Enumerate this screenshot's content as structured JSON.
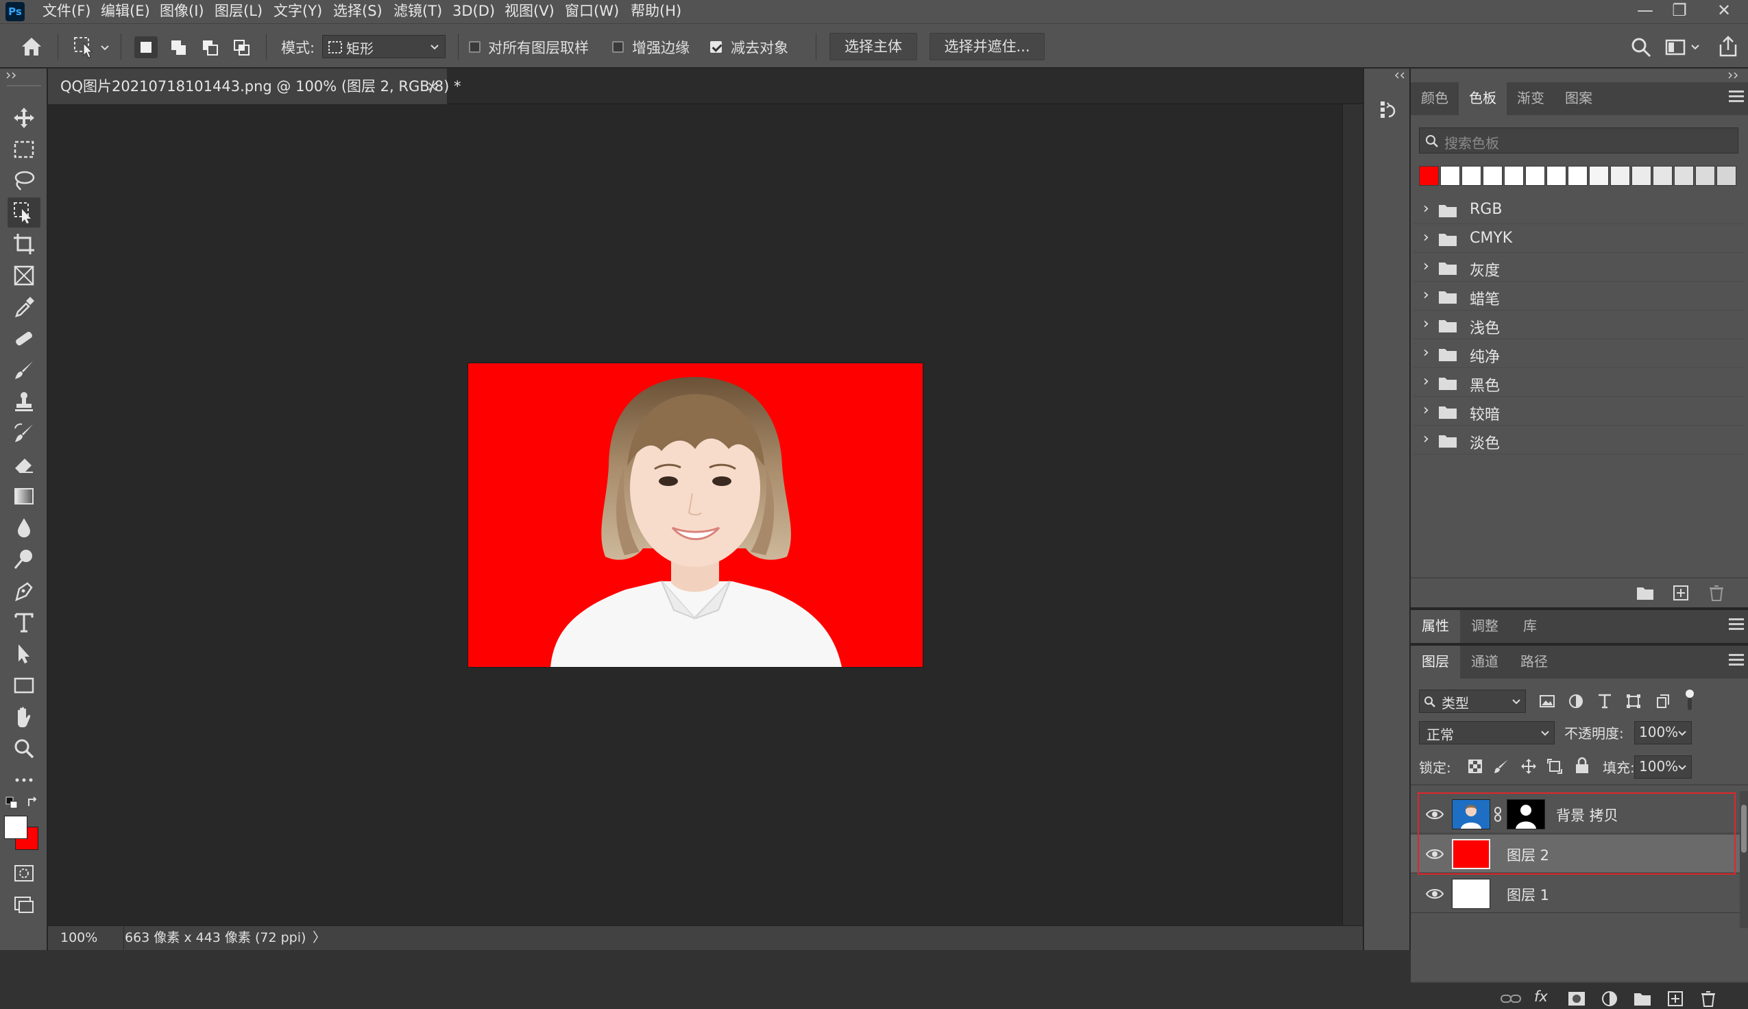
{
  "app": {
    "logo": "Ps"
  },
  "menu": [
    "文件(F)",
    "编辑(E)",
    "图像(I)",
    "图层(L)",
    "文字(Y)",
    "选择(S)",
    "滤镜(T)",
    "3D(D)",
    "视图(V)",
    "窗口(W)",
    "帮助(H)"
  ],
  "window_controls": {
    "minimize": "—",
    "restore": "❐",
    "close": "✕"
  },
  "options": {
    "mode_label": "模式:",
    "mode_value": "矩形",
    "sample_all_layers": {
      "label": "对所有图层取样",
      "checked": false
    },
    "enhance_edge": {
      "label": "增强边缘",
      "checked": false
    },
    "subtract_object": {
      "label": "减去对象",
      "checked": true
    },
    "select_subject_button": "选择主体",
    "select_and_mask_button": "选择并遮住..."
  },
  "document": {
    "tab_title": "QQ图片20210718101443.png @ 100% (图层 2, RGB/8) *",
    "close_glyph": "×",
    "background_color": "#ff0000",
    "zoom": "100%",
    "doc_info": "663 像素 x 443 像素 (72 ppi)",
    "status_arrow": "〉"
  },
  "swatches_panel": {
    "tabs": [
      "颜色",
      "色板",
      "渐变",
      "图案"
    ],
    "active_tab": "色板",
    "search_placeholder": "搜索色板",
    "recent_colors": [
      "#ff0000",
      "#ffffff",
      "#ffffff",
      "#ffffff",
      "#ffffff",
      "#ffffff",
      "#ffffff",
      "#ffffff",
      "#f5f5f5",
      "#f0f0f0",
      "#ebebeb",
      "#e6e6e6",
      "#e0e0e0",
      "#dbdbdb",
      "#d6d6d6"
    ],
    "groups": [
      "RGB",
      "CMYK",
      "灰度",
      "蜡笔",
      "浅色",
      "纯净",
      "黑色",
      "较暗",
      "淡色"
    ]
  },
  "properties_panel": {
    "tabs": [
      "属性",
      "调整",
      "库"
    ],
    "active_tab": "属性"
  },
  "layers_panel": {
    "tabs": [
      "图层",
      "通道",
      "路径"
    ],
    "active_tab": "图层",
    "filter_label": "类型",
    "blend_mode": "正常",
    "opacity_label": "不透明度:",
    "opacity_value": "100%",
    "lock_label": "锁定:",
    "fill_label": "填充:",
    "fill_value": "100%",
    "layers": [
      {
        "name": "背景 拷贝",
        "visible": true,
        "thumb": "photo",
        "has_mask": true
      },
      {
        "name": "图层 2",
        "visible": true,
        "thumb": "#ff0000",
        "selected": true
      },
      {
        "name": "图层 1",
        "visible": true,
        "thumb": "#ffffff"
      }
    ]
  },
  "colors": {
    "foreground": "#ffffff",
    "background": "#ff0000",
    "highlight_box": "#e0262b"
  }
}
